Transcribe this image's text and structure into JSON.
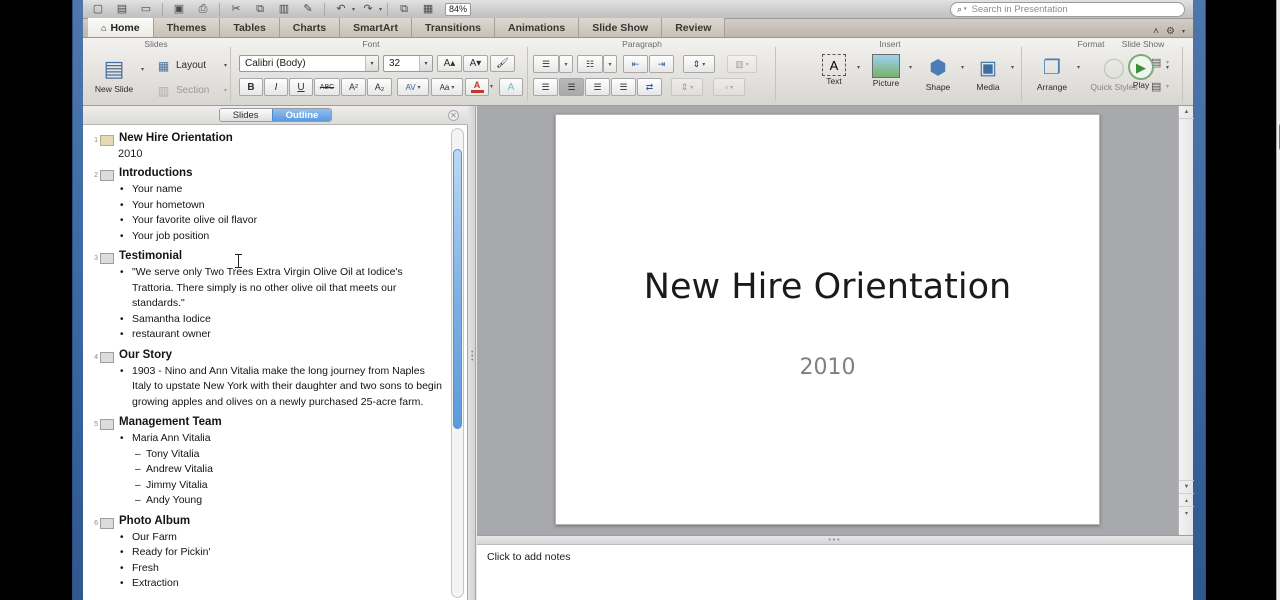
{
  "standard_toolbar": {
    "icons": [
      {
        "name": "new-document-icon",
        "glyph": "▢"
      },
      {
        "name": "open-media-browser-icon",
        "glyph": "▤"
      },
      {
        "name": "open-icon",
        "glyph": "▭"
      },
      {
        "name": "save-icon",
        "glyph": "Ὃe"
      },
      {
        "name": "print-icon",
        "glyph": "⎙"
      },
      {
        "name": "cut-icon",
        "glyph": "✂"
      },
      {
        "name": "copy-icon",
        "glyph": "⧉"
      },
      {
        "name": "paste-icon",
        "glyph": "Ὄb"
      },
      {
        "name": "format-painter-icon",
        "glyph": "✎"
      },
      {
        "name": "undo-icon",
        "glyph": "↶"
      },
      {
        "name": "redo-icon",
        "glyph": "↷"
      },
      {
        "name": "hyperlink-icon",
        "glyph": "⧉"
      },
      {
        "name": "show-presentation-icon",
        "glyph": "▦"
      }
    ],
    "zoom_level": "84%",
    "search": {
      "placeholder": "Search in Presentation",
      "value": "",
      "magnifier_glyph": "⌕"
    }
  },
  "ribbon_tabs": {
    "items": [
      {
        "label": "Home",
        "active": true,
        "icon": "home-icon"
      },
      {
        "label": "Themes",
        "active": false
      },
      {
        "label": "Tables",
        "active": false
      },
      {
        "label": "Charts",
        "active": false
      },
      {
        "label": "SmartArt",
        "active": false
      },
      {
        "label": "Transitions",
        "active": false
      },
      {
        "label": "Animations",
        "active": false
      },
      {
        "label": "Slide Show",
        "active": false
      },
      {
        "label": "Review",
        "active": false
      }
    ],
    "collapse_glyph": "˄",
    "gear_glyph": "⚙",
    "gear_caret": "▾"
  },
  "ribbon": {
    "groups": [
      {
        "title": "Slides"
      },
      {
        "title": "Font"
      },
      {
        "title": "Paragraph"
      },
      {
        "title": "Insert"
      },
      {
        "title": "Format"
      },
      {
        "title": "Slide Show"
      }
    ],
    "slides_group": {
      "new_slide_label": "New Slide",
      "new_slide_glyph": "▤",
      "layout_label": "Layout",
      "layout_glyph": "▦",
      "section_label": "Section",
      "section_glyph": "▥",
      "caret": "▾"
    },
    "font_group": {
      "font_name": "Calibri (Body)",
      "font_size": "32",
      "grow_font": "A▴",
      "shrink_font": "A▾",
      "clear_formatting": "A⌀",
      "bold": "B",
      "italic": "I",
      "underline": "U",
      "strikethrough": "ABC",
      "superscript": "A²",
      "subscript": "A₂",
      "character_spacing": "AV",
      "change_case": "Aa",
      "font_color": "A",
      "highlight_color": "A",
      "caret": "▾"
    },
    "paragraph_group": {
      "bullets": "☰",
      "numbering": "☷",
      "decrease_indent": "←≡",
      "increase_indent": "→≡",
      "line_spacing": "↕≡",
      "columns": "‖",
      "align_left": "≡",
      "align_center": "≡",
      "align_right": "≡",
      "justify": "≡",
      "text_direction": "⇄",
      "align_text": "↕",
      "convert_smartart": "◫",
      "caret": "▾"
    },
    "insert_group": {
      "text_label": "Text",
      "text_glyph": "A",
      "picture_label": "Picture",
      "picture_glyph": "⛰",
      "shape_label": "Shape",
      "shape_glyph": "⬟",
      "media_label": "Media",
      "media_glyph": "Ἱe",
      "caret": "▾"
    },
    "format_group": {
      "arrange_label": "Arrange",
      "arrange_glyph": "◫",
      "quick_styles_label": "Quick Styles",
      "quick_styles_glyph": "◯",
      "shape_fill_glyph": "△",
      "shape_line_glyph": "╱",
      "caret": "▾"
    },
    "slideshow_group": {
      "play_label": "Play",
      "play_glyph": "▶",
      "caret": "▾"
    }
  },
  "outline_pane": {
    "tabs": [
      {
        "label": "Slides",
        "active": false
      },
      {
        "label": "Outline",
        "active": true
      }
    ],
    "close_glyph": "✕",
    "slides": [
      {
        "number": "1",
        "title": "New Hire Orientation",
        "subtitle": "2010",
        "bullets": []
      },
      {
        "number": "2",
        "title": "Introductions",
        "bullets": [
          {
            "level": 1,
            "text": "Your name"
          },
          {
            "level": 1,
            "text": "Your hometown"
          },
          {
            "level": 1,
            "text": "Your favorite olive oil flavor"
          },
          {
            "level": 1,
            "text": "Your job position"
          }
        ]
      },
      {
        "number": "3",
        "title": "Testimonial",
        "bullets": [
          {
            "level": 1,
            "text": "\"We serve only Two Trees Extra Virgin Olive Oil at Iodice's Trattoria. There simply is no other olive oil that meets our standards.\""
          },
          {
            "level": 1,
            "text": "Samantha Iodice"
          },
          {
            "level": 1,
            "text": "restaurant owner"
          }
        ]
      },
      {
        "number": "4",
        "title": "Our Story",
        "bullets": [
          {
            "level": 1,
            "text": "1903 - Nino and Ann Vitalia make the long journey from Naples Italy to upstate New York with their daughter and two sons to begin growing apples and olives on a newly purchased 25-acre farm."
          }
        ]
      },
      {
        "number": "5",
        "title": "Management Team",
        "bullets": [
          {
            "level": 1,
            "text": "Maria Ann Vitalia"
          },
          {
            "level": 2,
            "text": "Tony Vitalia"
          },
          {
            "level": 2,
            "text": "Andrew Vitalia"
          },
          {
            "level": 2,
            "text": "Jimmy Vitalia"
          },
          {
            "level": 2,
            "text": "Andy Young"
          }
        ]
      },
      {
        "number": "6",
        "title": "Photo Album",
        "bullets": [
          {
            "level": 1,
            "text": "Our Farm"
          },
          {
            "level": 1,
            "text": "Ready for Pickin'"
          },
          {
            "level": 1,
            "text": "Fresh"
          },
          {
            "level": 1,
            "text": "Extraction"
          }
        ]
      }
    ]
  },
  "slide_editor": {
    "title": "New Hire Orientation",
    "subtitle": "2010",
    "scroll_up_glyph": "▲",
    "scroll_down_glyph": "▼",
    "prev_slide_glyph": "▴",
    "next_slide_glyph": "▾"
  },
  "notes_pane": {
    "placeholder": "Click to add notes",
    "grip_glyph": "•••"
  },
  "window_scrollbar": {
    "up_glyph": "▲",
    "down_glyph": "▼"
  }
}
